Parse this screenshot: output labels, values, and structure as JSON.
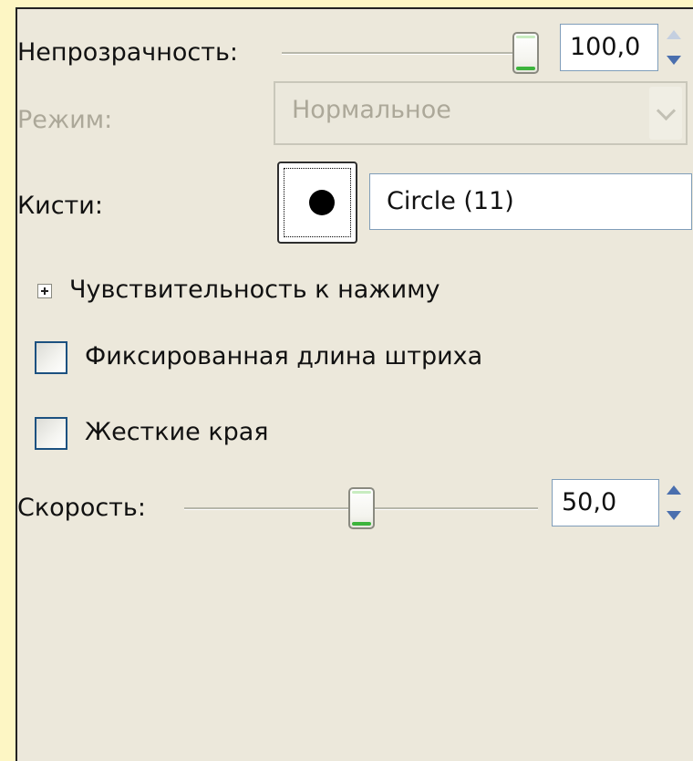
{
  "opacity": {
    "label": "Непрозрачность:",
    "value": "100,0",
    "fraction": 1.0
  },
  "mode": {
    "label": "Режим:",
    "value": "Нормальное"
  },
  "brush": {
    "label": "Кисти:",
    "name": "Circle (11)"
  },
  "pressure": {
    "label": "Чувствительность к нажиму"
  },
  "fixed_stroke": {
    "label": "Фиксированная длина штриха",
    "checked": false
  },
  "hard_edges": {
    "label": "Жесткие края",
    "checked": false
  },
  "rate": {
    "label": "Скорость:",
    "value": "50,0",
    "fraction": 0.5
  },
  "colors": {
    "background": "#ece8db",
    "frame": "#fdf6c4",
    "spin_arrow": "#4a6fae",
    "thumb_accent": "#3cb43c"
  }
}
